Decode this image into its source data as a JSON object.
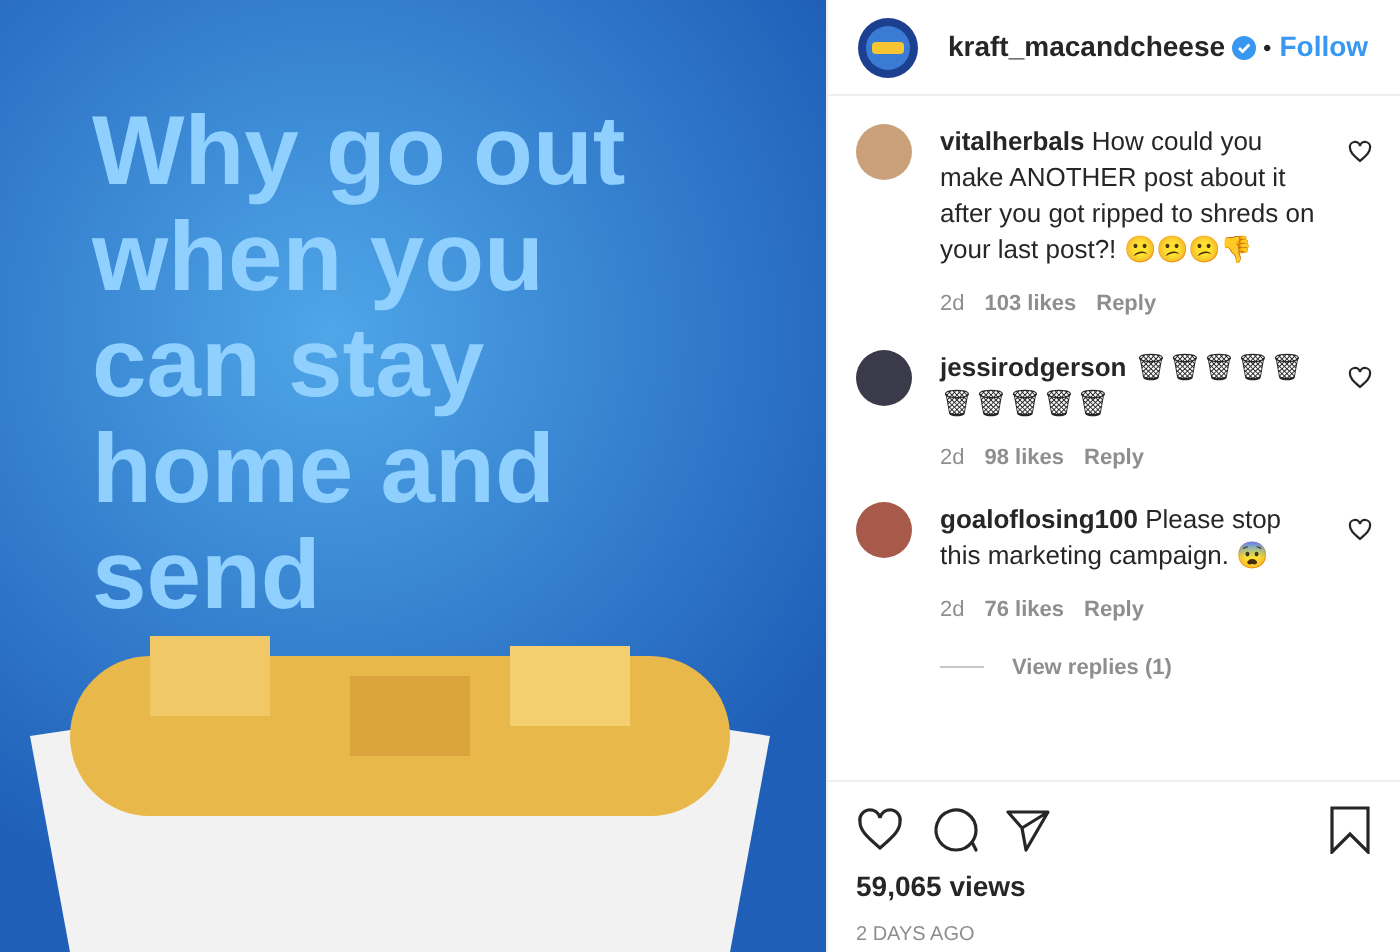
{
  "post_image": {
    "headline": "Why go out when you can stay home and send"
  },
  "header": {
    "username": "kraft_macandcheese",
    "verified": true,
    "separator": "•",
    "follow": "Follow"
  },
  "comments": [
    {
      "username": "vitalherbals",
      "text": "How could you make ANOTHER post about it after you got ripped to shreds on your last post?! 😕😕😕👎",
      "age": "2d",
      "likes": "103 likes",
      "reply": "Reply"
    },
    {
      "username": "jessirodgerson",
      "text": "🗑🗑🗑🗑🗑🗑🗑🗑🗑🗑",
      "age": "2d",
      "likes": "98 likes",
      "reply": "Reply"
    },
    {
      "username": "goaloflosing100",
      "text": "Please stop this marketing campaign. 😨",
      "age": "2d",
      "likes": "76 likes",
      "reply": "Reply",
      "view_replies": "View replies (1)"
    }
  ],
  "views": "59,065 views",
  "posted": "2 DAYS AGO"
}
